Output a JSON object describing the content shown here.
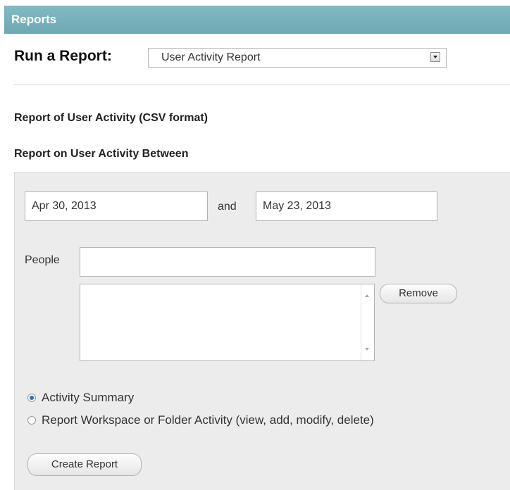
{
  "window": {
    "title": "Reports"
  },
  "run_report": {
    "label": "Run a Report:",
    "selected_report": "User Activity Report"
  },
  "section": {
    "csv_heading": "Report of User Activity (CSV format)",
    "between_heading": "Report on User Activity Between"
  },
  "dates": {
    "start": "Apr 30, 2013",
    "and_label": "and",
    "end": "May 23, 2013"
  },
  "people": {
    "label": "People",
    "input_value": "",
    "remove_label": "Remove"
  },
  "options": [
    {
      "label": "Activity Summary",
      "selected": true
    },
    {
      "label": "Report Workspace or Folder Activity (view, add, modify, delete)",
      "selected": false
    }
  ],
  "actions": {
    "create_label": "Create Report"
  },
  "colors": {
    "title_bar": "#74adb7",
    "panel_bg": "#ececec",
    "radio_selected": "#2d6fc1"
  },
  "icons": {
    "dropdown": "chevron-down-icon",
    "scroll_up": "scroll-up-icon",
    "scroll_down": "scroll-down-icon"
  }
}
